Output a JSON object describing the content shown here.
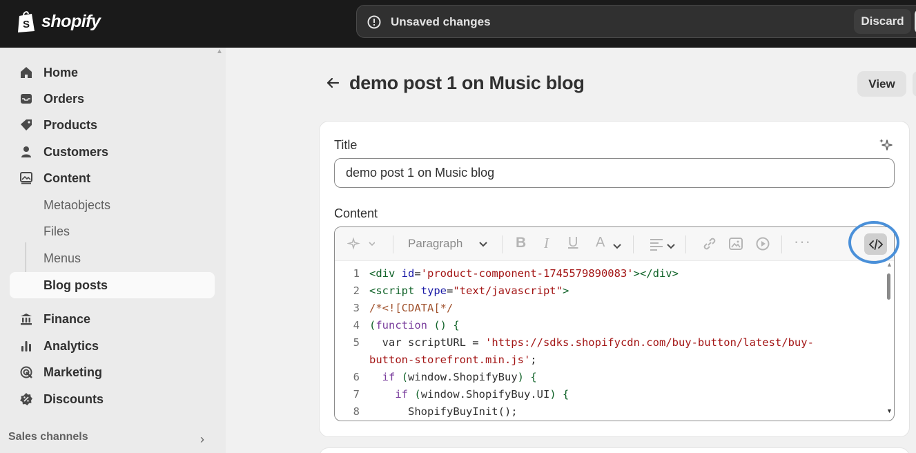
{
  "app": {
    "brand": "shopify"
  },
  "topbar": {
    "unsaved_text": "Unsaved changes",
    "discard_label": "Discard"
  },
  "sidebar": {
    "items": [
      {
        "label": "Home",
        "icon": "home-icon"
      },
      {
        "label": "Orders",
        "icon": "inbox-icon"
      },
      {
        "label": "Products",
        "icon": "tag-icon"
      },
      {
        "label": "Customers",
        "icon": "person-icon"
      },
      {
        "label": "Content",
        "icon": "image-icon"
      }
    ],
    "content_sub": [
      "Metaobjects",
      "Files",
      "Menus",
      "Blog posts"
    ],
    "items_2": [
      {
        "label": "Finance",
        "icon": "bank-icon"
      },
      {
        "label": "Analytics",
        "icon": "bar-chart-icon"
      },
      {
        "label": "Marketing",
        "icon": "target-icon"
      },
      {
        "label": "Discounts",
        "icon": "discount-icon"
      }
    ],
    "sales_channels": "Sales channels"
  },
  "page": {
    "title": "demo post 1 on Music blog",
    "view_label": "View"
  },
  "form": {
    "title_label": "Title",
    "title_value": "demo post 1 on Music blog",
    "content_label": "Content",
    "toolbar": {
      "paragraph": "Paragraph"
    }
  },
  "code_lines": [
    {
      "n": "1",
      "parts": [
        [
          "tag",
          "<div "
        ],
        [
          "attr",
          "id"
        ],
        [
          "plain",
          "="
        ],
        [
          "str",
          "'product-component-1745579890083'"
        ],
        [
          "tag",
          "></div>"
        ]
      ]
    },
    {
      "n": "2",
      "parts": [
        [
          "tag",
          "<script "
        ],
        [
          "attr",
          "type"
        ],
        [
          "plain",
          "="
        ],
        [
          "str",
          "\"text/javascript\""
        ],
        [
          "tag",
          ">"
        ]
      ]
    },
    {
      "n": "3",
      "parts": [
        [
          "cmt",
          "/*<![CDATA[*/"
        ]
      ]
    },
    {
      "n": "4",
      "parts": [
        [
          "punc",
          "("
        ],
        [
          "kw",
          "function"
        ],
        [
          "plain",
          " "
        ],
        [
          "punc",
          "() {"
        ]
      ]
    },
    {
      "n": "5",
      "parts": [
        [
          "plain",
          "  var scriptURL = "
        ],
        [
          "str",
          "'https://sdks.shopifycdn.com/buy-button/latest/buy-"
        ]
      ]
    },
    {
      "n": "",
      "parts": [
        [
          "str",
          "button-storefront.min.js'"
        ],
        [
          "plain",
          ";"
        ]
      ]
    },
    {
      "n": "6",
      "parts": [
        [
          "plain",
          "  "
        ],
        [
          "kw",
          "if"
        ],
        [
          "plain",
          " "
        ],
        [
          "punc",
          "("
        ],
        [
          "plain",
          "window.ShopifyBuy"
        ],
        [
          "punc",
          ") {"
        ]
      ]
    },
    {
      "n": "7",
      "parts": [
        [
          "plain",
          "    "
        ],
        [
          "kw",
          "if"
        ],
        [
          "plain",
          " "
        ],
        [
          "punc",
          "("
        ],
        [
          "plain",
          "window.ShopifyBuy.UI"
        ],
        [
          "punc",
          ") {"
        ]
      ]
    },
    {
      "n": "8",
      "parts": [
        [
          "plain",
          "      ShopifyBuyInit();"
        ]
      ]
    }
  ]
}
